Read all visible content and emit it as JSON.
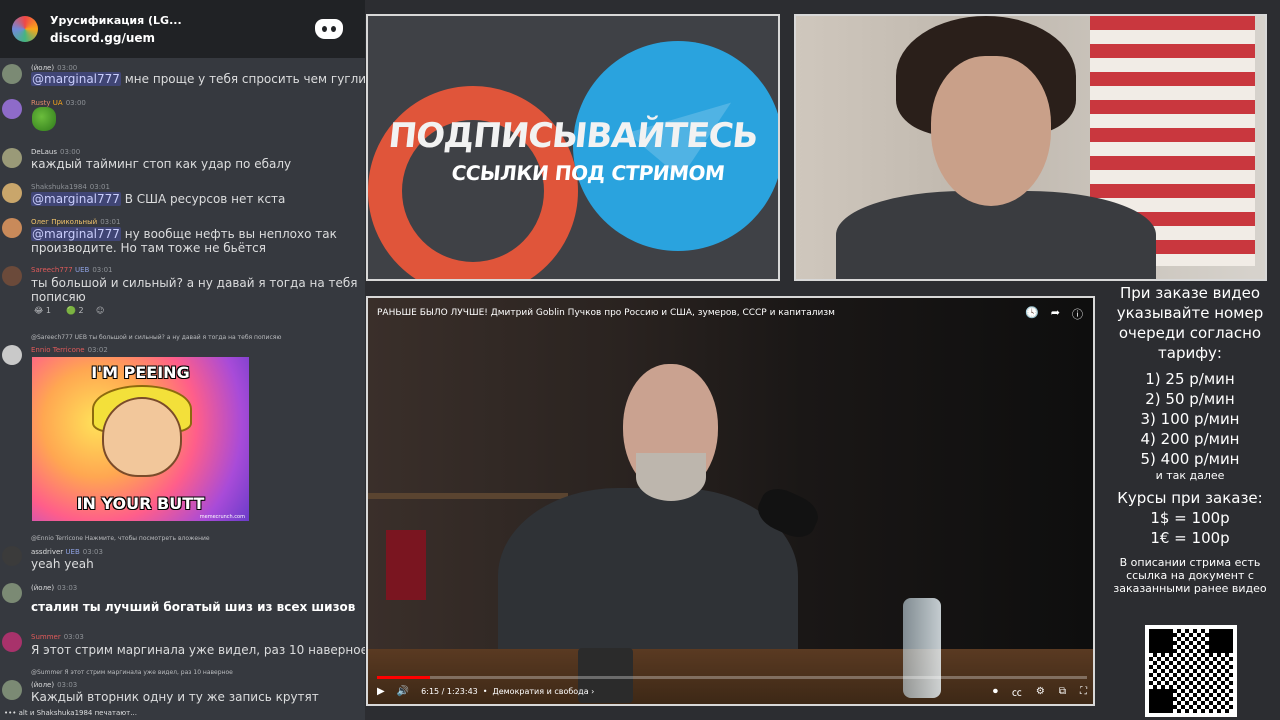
{
  "discord": {
    "server_name": "Урусификация (LG...",
    "invite": "discord.gg/uem"
  },
  "messages": [
    {
      "author": "(йоле)",
      "time": "03:00",
      "text": "мне проще у тебя спросить чем гуглить",
      "mention": "@marginal777"
    },
    {
      "author": "Rusty",
      "time": "03:00",
      "badge": "UA"
    },
    {
      "author": "DeLaus",
      "time": "03:00",
      "text": "каждый тайминг стоп как удар по ебалу"
    },
    {
      "author": "Shakshuka1984",
      "time": "03:01",
      "text": "В США ресурсов нет кста",
      "mention": "@marginal777"
    },
    {
      "author": "Олег Прикольный",
      "time": "03:01",
      "text": "ну вообще нефть вы неплохо так производите. Но там тоже не бьётся",
      "mention": "@marginal777"
    },
    {
      "author": "Sareech777",
      "time": "03:01",
      "badge": "UEB",
      "text": "ты большой и сильный? а ну давай я тогда на тебя пописяю",
      "reactions": [
        "1",
        "2"
      ]
    },
    {
      "author": "Ennio Terricone",
      "time": "03:02",
      "reply": "@Sareech777 UEB ты большой и сильный? а ну давай я тогда на тебя пописяю"
    },
    {
      "author": "assdriver",
      "time": "03:03",
      "badge": "UEB",
      "text": "yeah yeah",
      "reply": "@Ennio Terricone Нажмите, чтобы посмотреть вложение"
    },
    {
      "author": "(йоле)",
      "time": "03:03",
      "text": "сталин ты лучший богатый шиз из всех шизов"
    },
    {
      "author": "Summer",
      "time": "03:03",
      "text": "Я этот стрим маргинала уже видел, раз 10 наверное"
    },
    {
      "author": "(йоле)",
      "time": "03:03",
      "text": "Каждый вторник одну и ту же запись крутят",
      "reply": "@Summer Я этот стрим маргинала уже видел, раз 10 наверное"
    }
  ],
  "meme": {
    "top": "I'M PEEING",
    "bottom": "IN YOUR BUTT",
    "watermark": "memecrunch.com"
  },
  "typing": "alt и Shakshuka1984 печатают...",
  "promo": {
    "title": "ПОДПИСЫВАЙТЕСЬ",
    "subtitle": "ССЫЛКИ ПОД СТРИМОМ"
  },
  "video": {
    "title": "РАНЬШЕ БЫЛО ЛУЧШЕ! Дмитрий Goblin Пучков про Россию и США, зумеров, СССР и капитализм",
    "time": "6:15 / 1:23:43",
    "chapter": "Демократия и свобода",
    "progress": 0.075
  },
  "info": {
    "intro": "При заказе видео указывайте номер очереди согласно тарифу:",
    "tariffs": [
      "1) 25 р/мин",
      "2) 50 р/мин",
      "3) 100 р/мин",
      "4) 200 р/мин",
      "5) 400 р/мин"
    ],
    "etc": "и так далее",
    "rates_title": "Курсы при заказе:",
    "rates": [
      "1$ = 100р",
      "1€ = 100р"
    ],
    "footer": "В описании стрима есть ссылка на документ с заказанными ранее видео"
  }
}
